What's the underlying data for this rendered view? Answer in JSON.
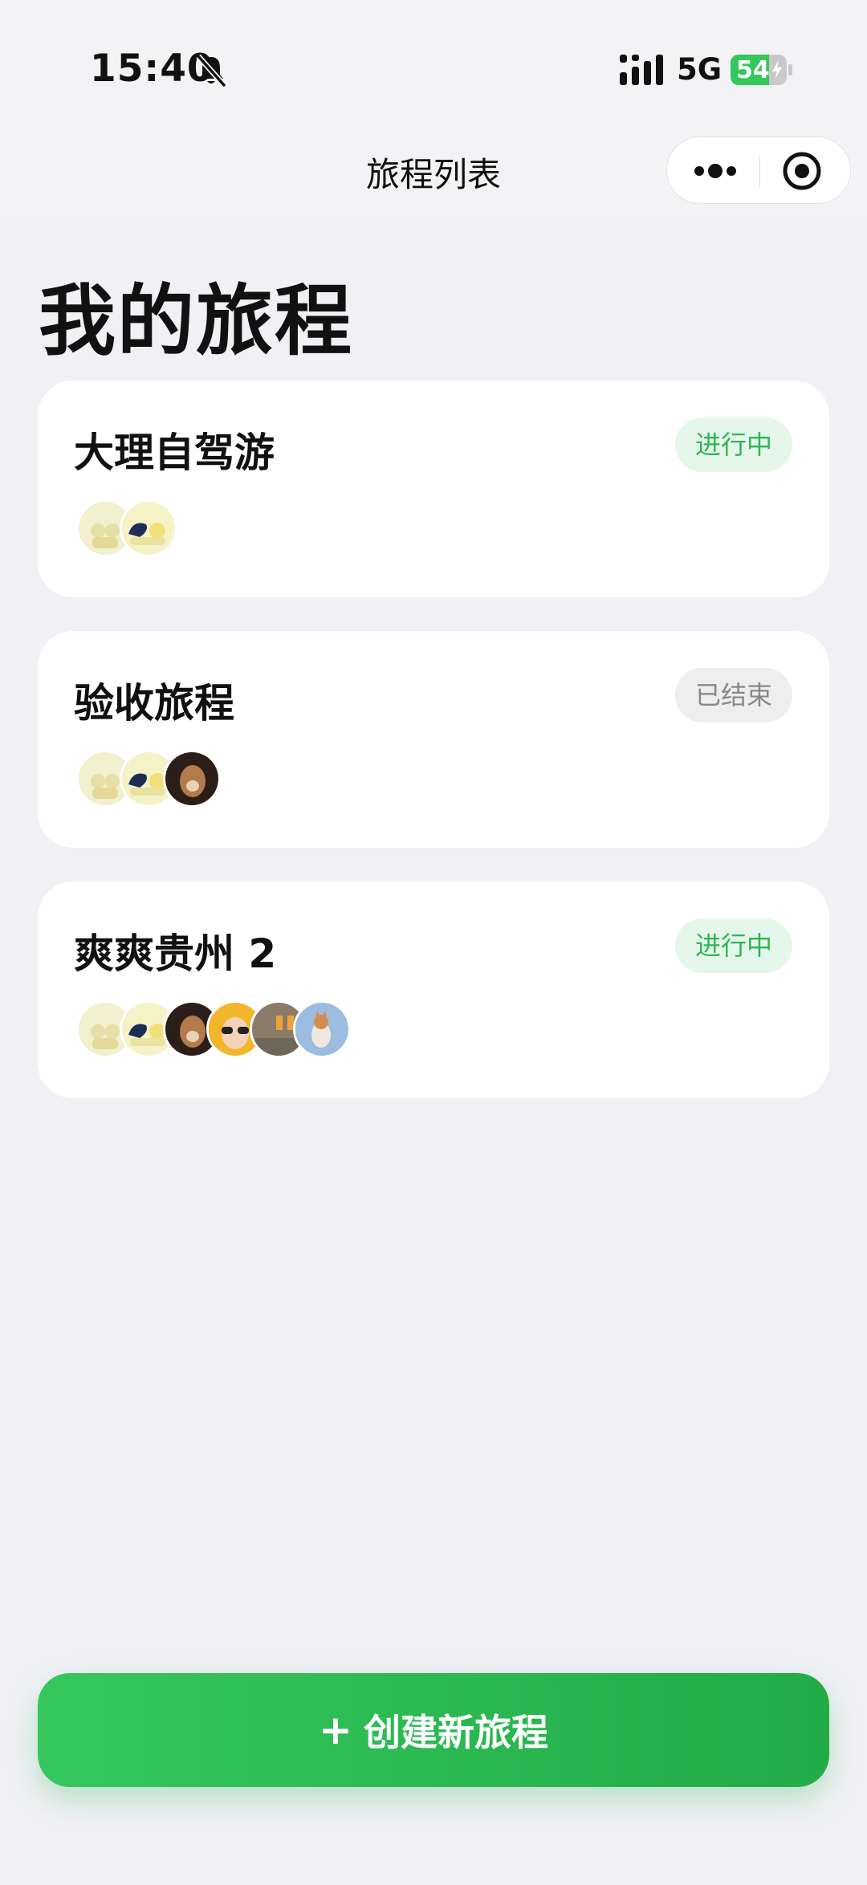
{
  "status_bar": {
    "time": "15:40",
    "network": "5G",
    "battery": "54"
  },
  "nav": {
    "title": "旅程列表"
  },
  "page": {
    "heading": "我的旅程"
  },
  "trips": [
    {
      "name": "大理自驾游",
      "status": "进行中"
    },
    {
      "name": "验收旅程",
      "status": "已结束"
    },
    {
      "name": "爽爽贵州 2",
      "status": "进行中"
    }
  ],
  "create_button": {
    "plus": "+",
    "label": "创建新旅程"
  },
  "colors": {
    "accent": "#2fb555",
    "button": "#2db851",
    "background": "#f1f1f5"
  },
  "icons": [
    "bell-mute-icon",
    "signal-icon",
    "battery-icon",
    "more-icon",
    "close-mini-program-icon",
    "plus-icon"
  ]
}
